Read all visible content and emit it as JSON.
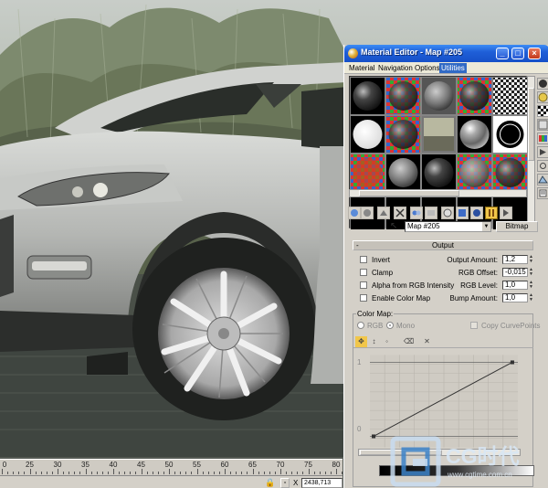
{
  "window": {
    "title": "Material Editor - Map #205",
    "minimize": "_",
    "maximize": "□",
    "close": "×"
  },
  "menu": {
    "items": [
      "Material",
      "Navigation",
      "Options",
      "Utilities"
    ],
    "active": "Utilities"
  },
  "map": {
    "name": "Map #205",
    "type_button": "Bitmap"
  },
  "rollout": {
    "title": "Output",
    "collapse_symbol": "-"
  },
  "output": {
    "checkboxes": [
      "Invert",
      "Clamp",
      "Alpha from RGB Intensity",
      "Enable Color Map"
    ],
    "params": [
      {
        "label": "Output Amount:",
        "value": "1,2"
      },
      {
        "label": "RGB Offset:",
        "value": "-0,015"
      },
      {
        "label": "RGB Level:",
        "value": "1,0"
      },
      {
        "label": "Bump Amount:",
        "value": "1,0"
      }
    ]
  },
  "color_map": {
    "group_label": "Color Map:",
    "rgb_label": "RGB",
    "mono_label": "Mono",
    "copy_label": "Copy CurvePoints",
    "y_top": "1",
    "y_bottom": "0"
  },
  "timeline": {
    "ticks": [
      "0",
      "25",
      "30",
      "35",
      "40",
      "45",
      "50",
      "55",
      "60",
      "65",
      "70",
      "75",
      "80"
    ],
    "coord_value": "2438,713",
    "x_label": "X"
  },
  "watermark": {
    "brand": "CG时代",
    "url": "www.cgtime.com.cn"
  },
  "colors": {
    "title_bar": "#1f5fd8",
    "panel": "#d4d0c8",
    "active_tool": "#f1c64a"
  }
}
